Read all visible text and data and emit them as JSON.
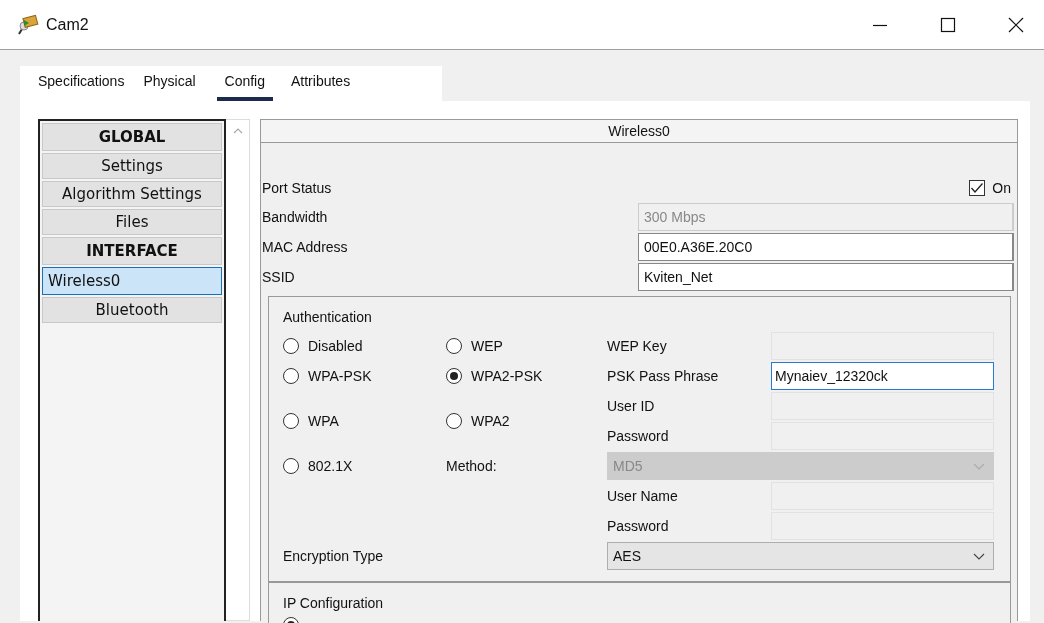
{
  "window": {
    "title": "Cam2"
  },
  "tabs": [
    {
      "label": "Specifications",
      "selected": false
    },
    {
      "label": "Physical",
      "selected": false
    },
    {
      "label": "Config",
      "selected": true
    },
    {
      "label": "Attributes",
      "selected": false
    }
  ],
  "sidebar": {
    "items": [
      {
        "label": "GLOBAL",
        "kind": "header",
        "selected": false
      },
      {
        "label": "Settings",
        "kind": "item",
        "selected": false
      },
      {
        "label": "Algorithm Settings",
        "kind": "item",
        "selected": false
      },
      {
        "label": "Files",
        "kind": "item",
        "selected": false
      },
      {
        "label": "INTERFACE",
        "kind": "header",
        "selected": false
      },
      {
        "label": "Wireless0",
        "kind": "item",
        "selected": true
      },
      {
        "label": "Bluetooth",
        "kind": "item",
        "selected": false
      }
    ]
  },
  "panel": {
    "title": "Wireless0",
    "port_status": {
      "label": "Port Status",
      "checked": true,
      "checkbox_label": "On"
    },
    "fields": [
      {
        "label": "Bandwidth",
        "value": "300 Mbps",
        "disabled": true
      },
      {
        "label": "MAC Address",
        "value": "00E0.A36E.20C0",
        "disabled": false
      },
      {
        "label": "SSID",
        "value": "Kviten_Net",
        "disabled": false
      }
    ],
    "authentication": {
      "title": "Authentication",
      "options": [
        {
          "label": "Disabled",
          "selected": false
        },
        {
          "label": "WEP",
          "selected": false
        },
        {
          "label": "WPA-PSK",
          "selected": false
        },
        {
          "label": "WPA2-PSK",
          "selected": true
        },
        {
          "label": "WPA",
          "selected": false
        },
        {
          "label": "WPA2",
          "selected": false
        },
        {
          "label": "802.1X",
          "selected": false
        }
      ],
      "method_label": "Method:",
      "method": {
        "value": "MD5",
        "disabled": true
      },
      "credentials": [
        {
          "label": "WEP Key",
          "focused": false
        },
        {
          "label": "PSK Pass Phrase",
          "value": "Mynaiev_12320ck",
          "focused": true
        },
        {
          "label": "User ID",
          "focused": false
        },
        {
          "label": "Password",
          "focused": false
        },
        {
          "label": "User Name",
          "focused": false
        },
        {
          "label": "Password",
          "focused": false
        }
      ],
      "encryption": {
        "label": "Encryption Type",
        "value": "AES",
        "disabled": false
      }
    },
    "ip_configuration": {
      "title": "IP Configuration",
      "options": [
        {
          "selected": true
        }
      ]
    }
  }
}
